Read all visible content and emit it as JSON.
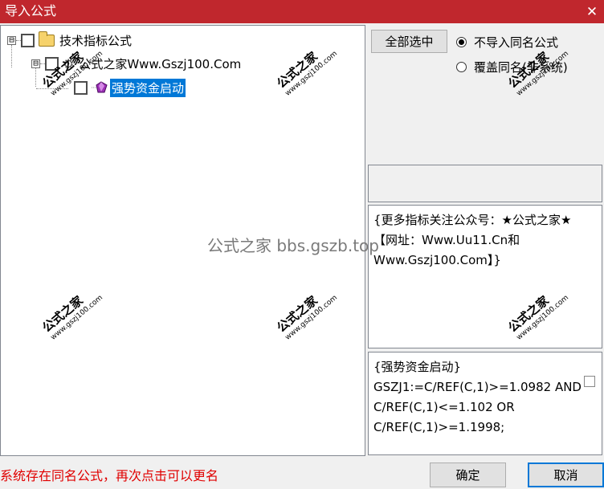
{
  "window": {
    "title": "导入公式",
    "close_label": "✕"
  },
  "tree": {
    "root": {
      "label": "技术指标公式",
      "expander": "⊟"
    },
    "group": {
      "label": "公式之家Www.Gszj100.Com",
      "expander": "⊟"
    },
    "item": {
      "label": "强势资金启动"
    }
  },
  "actions": {
    "select_all": "全部选中",
    "radio_skip": "不导入同名公式",
    "radio_overwrite": "覆盖同名(非系统)",
    "selected_radio": "skip"
  },
  "info_text": "{更多指标关注公众号：★公式之家★ 【网址：Www.Uu11.Cn和Www.Gszj100.Com】}",
  "code_text": "{强势资金启动}\nGSZJ1:=C/REF(C,1)>=1.0982 AND C/REF(C,1)<=1.102 OR C/REF(C,1)>=1.1998;",
  "status": "系统存在同名公式，再次点击可以更名",
  "buttons": {
    "ok": "确定",
    "cancel": "取消"
  },
  "watermark": {
    "title": "公式之家",
    "url": "www.gszj100.com",
    "center": "公式之家 bbs.gszb.top"
  }
}
